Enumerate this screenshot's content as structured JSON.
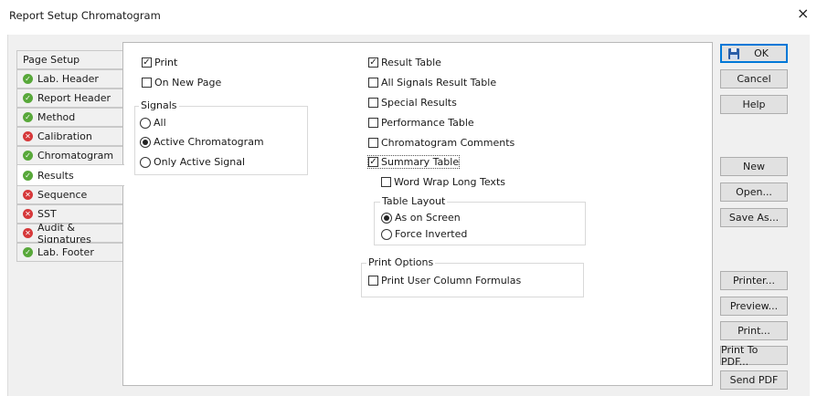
{
  "window": {
    "title": "Report Setup Chromatogram",
    "close_glyph": "×"
  },
  "tabs": [
    {
      "label": "Page Setup",
      "status": "none"
    },
    {
      "label": "Lab. Header",
      "status": "ok"
    },
    {
      "label": "Report Header",
      "status": "ok"
    },
    {
      "label": "Method",
      "status": "ok"
    },
    {
      "label": "Calibration",
      "status": "error"
    },
    {
      "label": "Chromatogram",
      "status": "ok"
    },
    {
      "label": "Results",
      "status": "ok",
      "selected": true
    },
    {
      "label": "Sequence",
      "status": "error"
    },
    {
      "label": "SST",
      "status": "error"
    },
    {
      "label": "Audit & Signatures",
      "status": "error"
    },
    {
      "label": "Lab. Footer",
      "status": "ok"
    }
  ],
  "left_options": {
    "print": {
      "label": "Print",
      "checked": true
    },
    "on_new_page": {
      "label": "On New Page",
      "checked": false
    },
    "signals": {
      "label": "Signals",
      "options": [
        {
          "label": "All",
          "selected": false
        },
        {
          "label": "Active Chromatogram",
          "selected": true
        },
        {
          "label": "Only Active Signal",
          "selected": false
        }
      ]
    }
  },
  "right_options": {
    "result_table": {
      "label": "Result Table",
      "checked": true
    },
    "all_signals_result_table": {
      "label": "All Signals Result Table",
      "checked": false
    },
    "special_results": {
      "label": "Special Results",
      "checked": false
    },
    "performance_table": {
      "label": "Performance Table",
      "checked": false
    },
    "chromatogram_comments": {
      "label": "Chromatogram Comments",
      "checked": false
    },
    "summary_table": {
      "label": "Summary Table",
      "checked": true
    },
    "word_wrap": {
      "label": "Word Wrap Long Texts",
      "checked": false
    },
    "table_layout": {
      "label": "Table Layout",
      "options": [
        {
          "label": "As on Screen",
          "selected": true
        },
        {
          "label": "Force Inverted",
          "selected": false
        }
      ]
    },
    "print_options": {
      "label": "Print Options",
      "print_user_column_formulas": {
        "label": "Print User Column Formulas",
        "checked": false
      }
    }
  },
  "buttons": {
    "ok": "OK",
    "cancel": "Cancel",
    "help": "Help",
    "new": "New",
    "open": "Open...",
    "save_as": "Save As...",
    "printer": "Printer...",
    "preview": "Preview...",
    "print": "Print...",
    "print_to_pdf": "Print To PDF...",
    "send_pdf": "Send PDF"
  },
  "colors": {
    "ok": "#58a83a",
    "error": "#d6383a",
    "default_border": "#0078d7"
  },
  "check_glyph": "✓"
}
